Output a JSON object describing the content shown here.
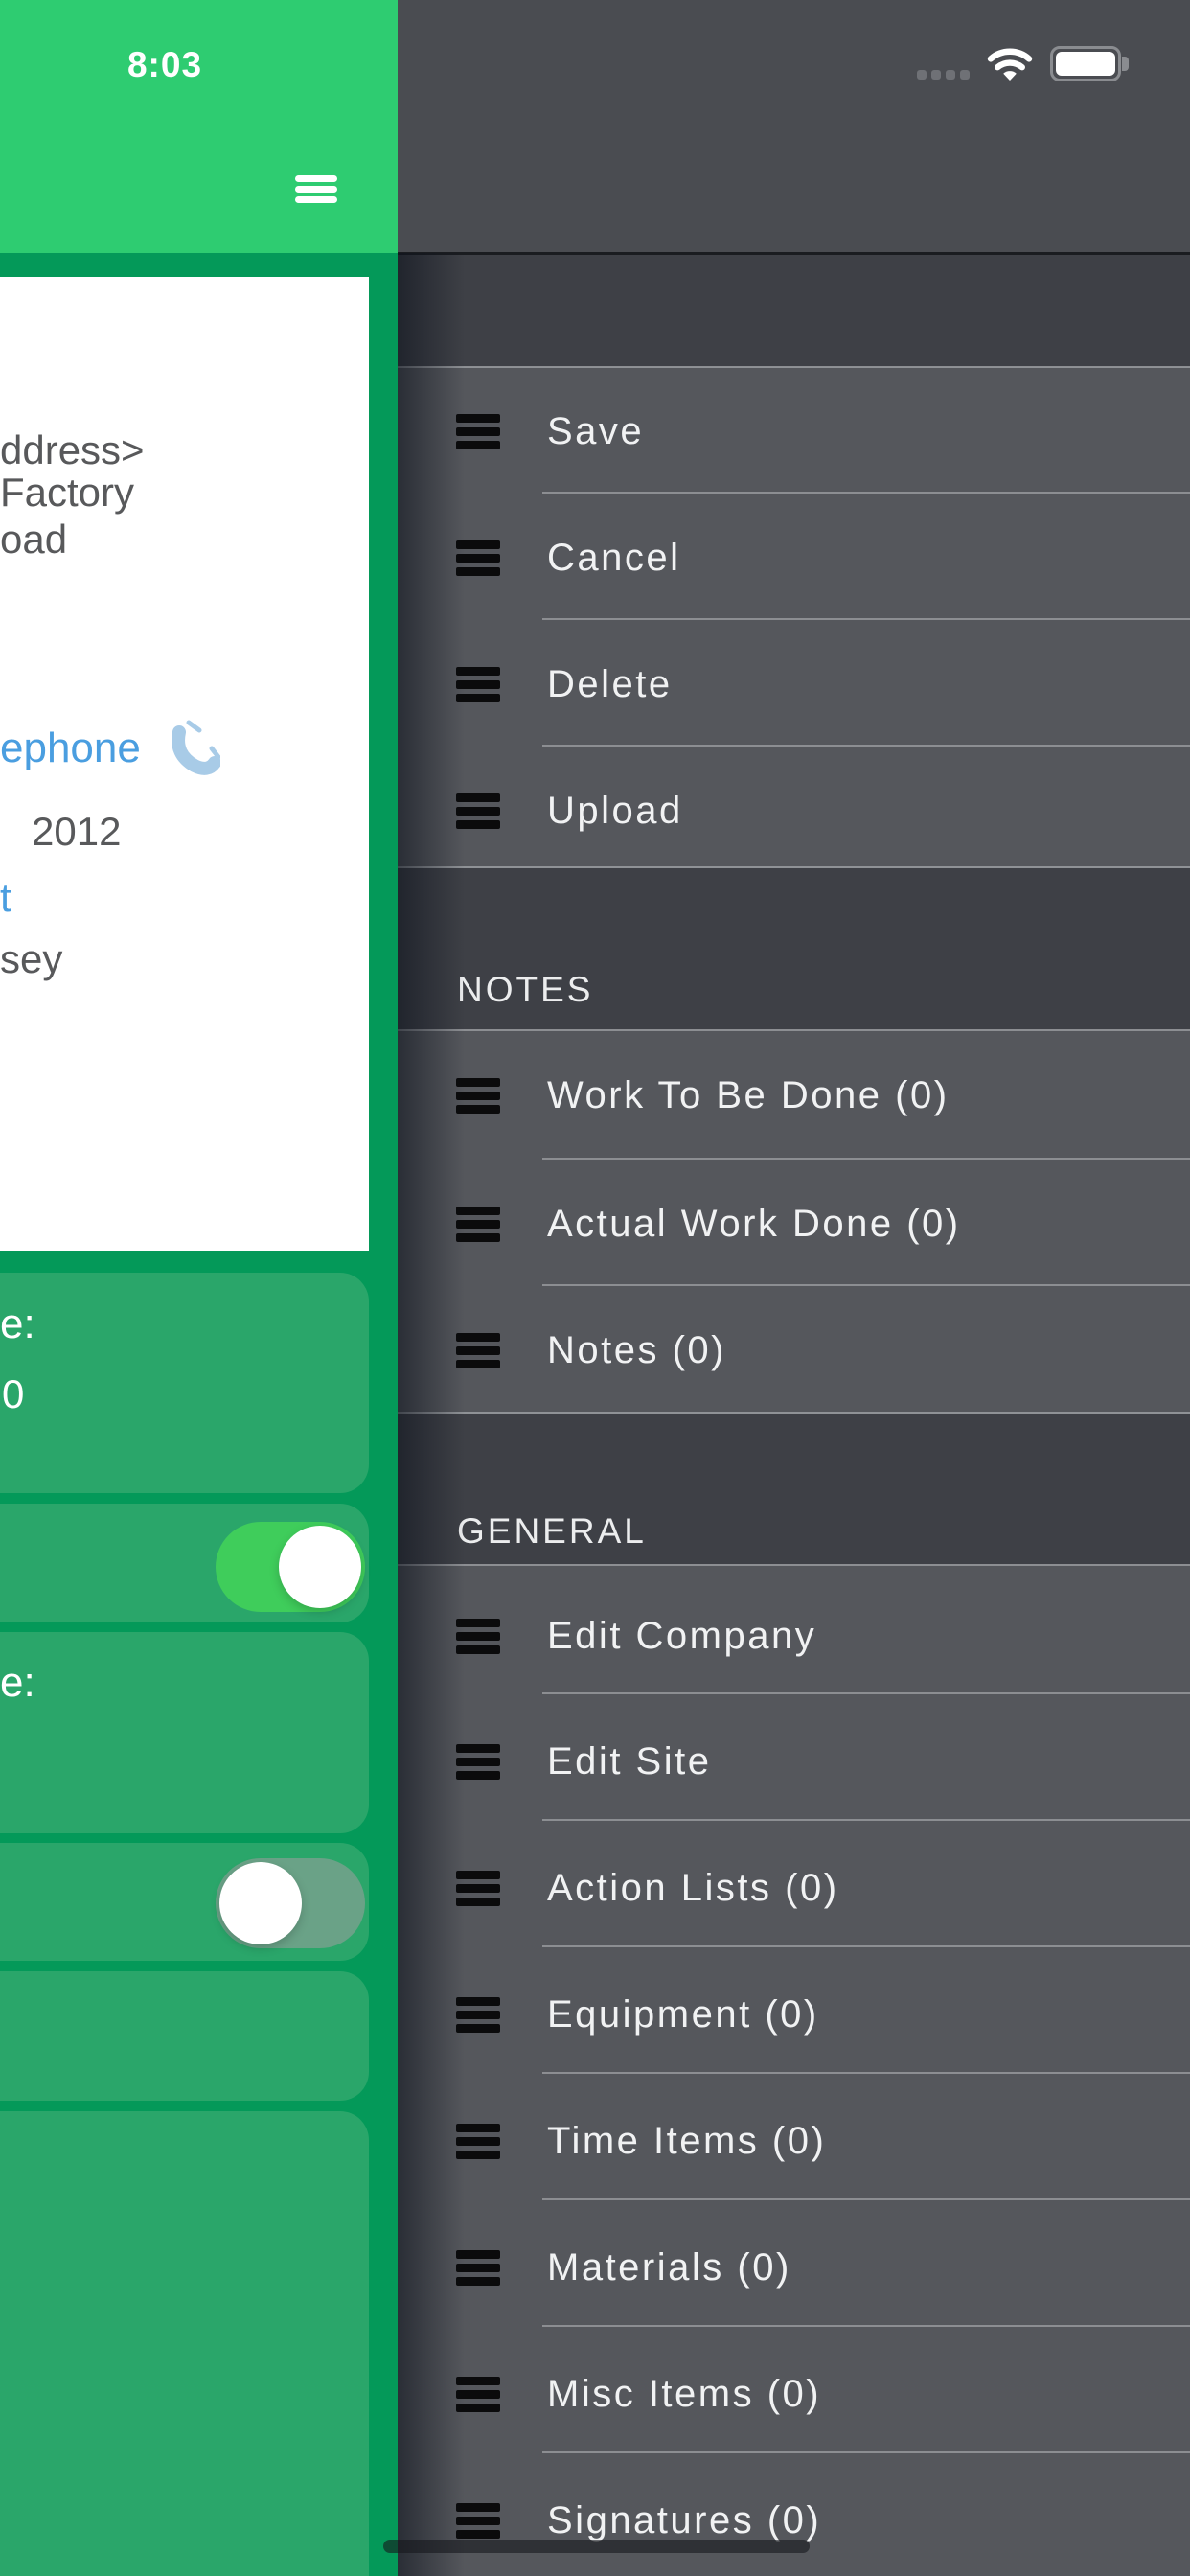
{
  "status_bar": {
    "time": "8:03",
    "signal_dots": 4,
    "wifi_icon": "wifi",
    "battery_icon": "battery-full"
  },
  "nav": {
    "menu_icon": "hamburger"
  },
  "detail_card": {
    "address_line1": "ddress>",
    "address_line2": "Factory",
    "address_line3": "oad",
    "telephone_fragment": "ephone",
    "phone_icon": "phone-receiver",
    "date_fragment": "2012",
    "link_fragment": "t",
    "region_fragment": "sey"
  },
  "info_cards": {
    "card1_label": "e:",
    "card1_value": "0",
    "card2_toggle": "on",
    "card3_label": "e:",
    "card4_toggle": "off"
  },
  "drawer": {
    "sections": [
      {
        "items": [
          {
            "label": "Save"
          },
          {
            "label": "Cancel"
          },
          {
            "label": "Delete"
          },
          {
            "label": "Upload"
          }
        ]
      },
      {
        "header": "NOTES",
        "items": [
          {
            "label": "Work To Be Done (0)"
          },
          {
            "label": "Actual Work Done (0)"
          },
          {
            "label": "Notes (0)"
          }
        ]
      },
      {
        "header": "GENERAL",
        "items": [
          {
            "label": "Edit Company"
          },
          {
            "label": "Edit Site"
          },
          {
            "label": "Action Lists (0)"
          },
          {
            "label": "Equipment (0)"
          },
          {
            "label": "Time Items (0)"
          },
          {
            "label": "Materials (0)"
          },
          {
            "label": "Misc Items (0)"
          },
          {
            "label": "Signatures (0)"
          }
        ]
      }
    ]
  },
  "colors": {
    "nav_green": "#2ECC71",
    "bg_green": "#049959",
    "card_green": "#2AA66A",
    "toggle_on": "#3FCD5B",
    "drawer_light": "#55575C",
    "drawer_dark": "#3E4046",
    "dim_top": "#4A4C51",
    "separator": "#9A9CA0",
    "text_gray": "#58595B",
    "text_blue": "#4A9EE0",
    "phone_blue": "#A8CBE7"
  }
}
